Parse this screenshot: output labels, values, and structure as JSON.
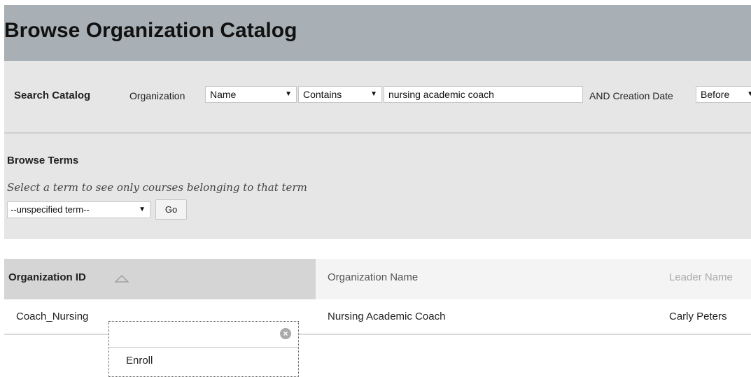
{
  "header": {
    "title": "Browse Organization Catalog"
  },
  "search": {
    "title": "Search Catalog",
    "field_label": "Organization",
    "field_select": "Name",
    "operator_select": "Contains",
    "query_value": "nursing academic coach",
    "date_label": "AND Creation Date",
    "date_select": "Before"
  },
  "terms": {
    "title": "Browse Terms",
    "help": "Select a term to see only courses belonging to that term",
    "term_select": "--unspecified term--",
    "go_label": "Go"
  },
  "table": {
    "columns": [
      "Organization ID",
      "Organization Name",
      "Leader Name"
    ],
    "rows": [
      {
        "id": "Coach_Nursing",
        "name": "Nursing Academic Coach",
        "leader": "Carly Peters"
      }
    ]
  },
  "context_menu": {
    "items": [
      "Enroll"
    ]
  },
  "icons": {
    "dropdown": "chevron-down-icon",
    "sort": "sort-ascending-icon",
    "close": "close-icon"
  }
}
